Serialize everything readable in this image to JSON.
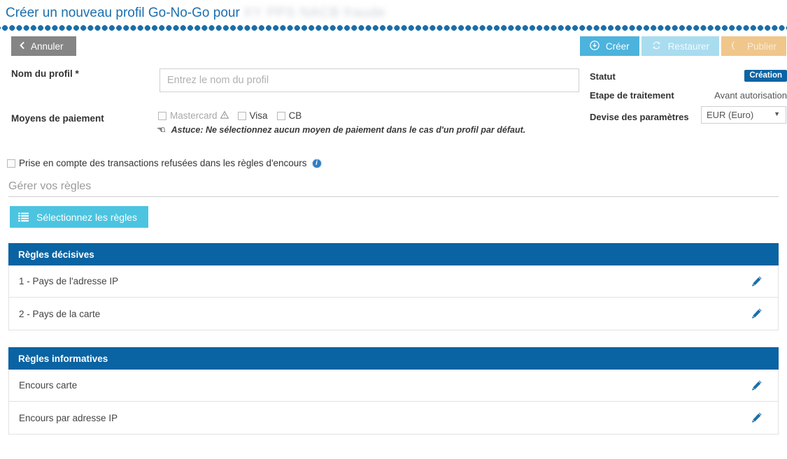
{
  "page": {
    "title_prefix": "Créer un nouveau profil Go-No-Go pour",
    "title_redacted": "XY PPS NACB fraude"
  },
  "toolbar": {
    "cancel_label": "Annuler",
    "cancel_icon": "chevron-left-icon",
    "create_label": "Créer",
    "create_icon": "download-circle-icon",
    "restore_label": "Restaurer",
    "restore_icon": "refresh-icon",
    "publish_label": "Publier",
    "publish_icon": "globe-icon"
  },
  "form": {
    "profile_name_label": "Nom du profil *",
    "profile_name_value": "",
    "profile_name_placeholder": "Entrez le nom du profil",
    "payment_means_label": "Moyens de paiement",
    "payment_options": [
      {
        "label": "Mastercard",
        "checked": false,
        "disabled": true,
        "warning": true
      },
      {
        "label": "Visa",
        "checked": false,
        "disabled": false,
        "warning": false
      },
      {
        "label": "CB",
        "checked": false,
        "disabled": false,
        "warning": false
      }
    ],
    "tip_icon": "pointing-hand-icon",
    "tip_text": "Astuce: Ne sélectionnez aucun moyen de paiement dans le cas d'un profil par défaut.",
    "declined_checkbox_label": "Prise en compte des transactions refusées dans les règles d'encours",
    "declined_checked": false,
    "declined_info_icon": "info-icon"
  },
  "status": {
    "statut_label": "Statut",
    "statut_value": "Création",
    "etape_label": "Etape de traitement",
    "etape_value": "Avant autorisation",
    "devise_label": "Devise des paramètres",
    "devise_value": "EUR (Euro)",
    "devise_options": [
      "EUR (Euro)"
    ]
  },
  "rules_section": {
    "heading": "Gérer vos règles",
    "select_button_label": "Sélectionnez les règles",
    "select_button_icon": "list-icon"
  },
  "tables": [
    {
      "header": "Règles décisives",
      "rows": [
        {
          "name": "1 - Pays de l'adresse IP",
          "edit_icon": "pencil-icon"
        },
        {
          "name": "2 - Pays de la carte",
          "edit_icon": "pencil-icon"
        }
      ]
    },
    {
      "header": "Règles informatives",
      "rows": [
        {
          "name": "Encours carte",
          "edit_icon": "pencil-icon"
        },
        {
          "name": "Encours par adresse IP",
          "edit_icon": "pencil-icon"
        }
      ]
    }
  ],
  "colors": {
    "title_blue": "#1a6fae",
    "header_blue": "#0a63a2",
    "create_blue": "#4cb3dd",
    "select_cyan": "#4cc4e0",
    "publish_tan": "#f0c68b",
    "cancel_grey": "#858585",
    "badge_blue": "#0d64a4",
    "pencil_blue": "#1b6ea8"
  }
}
